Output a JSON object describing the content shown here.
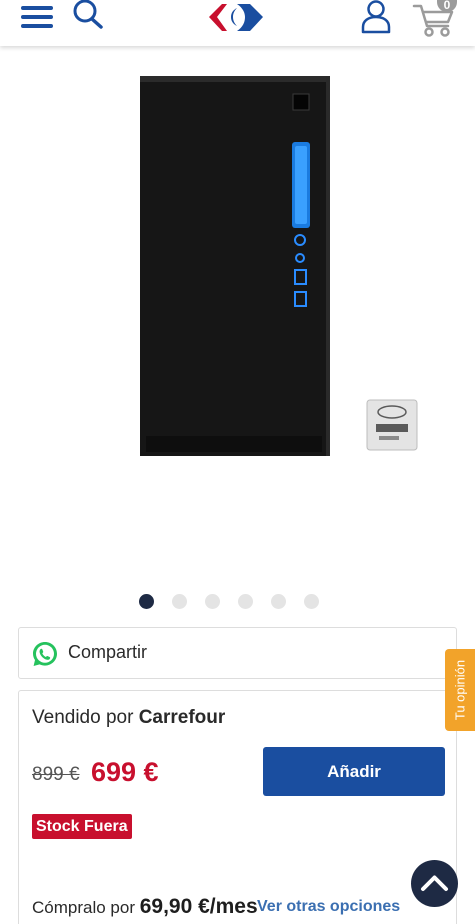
{
  "header": {
    "menu_icon": "hamburger-icon",
    "search_icon": "search-icon",
    "logo": "carrefour-logo",
    "user_icon": "user-icon",
    "cart_icon": "cart-icon",
    "cart_count": "0"
  },
  "gallery": {
    "image": "pc-tower-product-image",
    "slide_count": 6,
    "active_slide": 1
  },
  "share": {
    "icon": "whatsapp-icon",
    "label": "Compartir"
  },
  "offer": {
    "sold_by_prefix": "Vendido por",
    "seller": "Carrefour",
    "old_price": "899 €",
    "price": "699 €",
    "add_button": "Añadir",
    "stock_badge": "Stock Fuera",
    "buy_with_prefix": "Cómpralo por",
    "monthly_price": "69,90 €/mes",
    "other_options": "Ver otras opciones"
  },
  "opinion_tab": "Tu opinión",
  "scroll_top_icon": "chevron-up-icon",
  "colors": {
    "brand_blue": "#1a4ea0",
    "price_red": "#c8102e",
    "opinion_orange": "#f2a32a",
    "dark_navy": "#1e2a44"
  }
}
